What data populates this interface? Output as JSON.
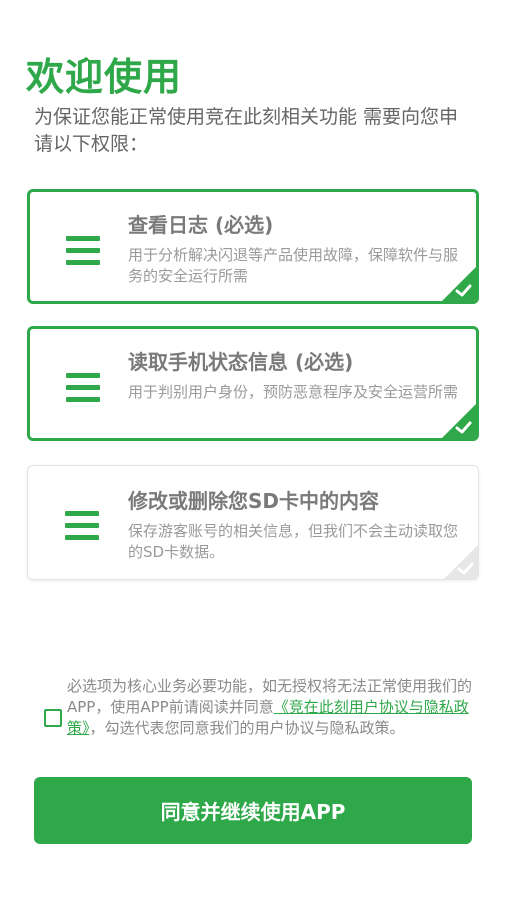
{
  "header": {
    "title": "欢迎使用",
    "subtitle": "为保证您能正常使用竞在此刻相关功能 需要向您申请以下权限："
  },
  "permissions": [
    {
      "title": "查看日志 (必选)",
      "description": "用于分析解决闪退等产品使用故障，保障软件与服务的安全运行所需",
      "checked": true
    },
    {
      "title": "读取手机状态信息 (必选)",
      "description": "用于判别用户身份，预防恶意程序及安全运营所需",
      "checked": true
    },
    {
      "title": "修改或删除您SD卡中的内容",
      "description": "保存游客账号的相关信息，但我们不会主动读取您的SD卡数据。",
      "checked": false
    }
  ],
  "agreement": {
    "checked": false,
    "text_before": "必选项为核心业务必要功能，如无授权将无法正常使用我们的APP，使用APP前请阅读并同意",
    "link": "《竞在此刻用户协议与隐私政策》",
    "text_after": "，勾选代表您同意我们的用户协议与隐私政策。"
  },
  "continue_button": "同意并继续使用APP",
  "colors": {
    "accent": "#2fa84a",
    "card_title": "#7a7a7a",
    "card_desc": "#9a9a9a",
    "unchecked_corner": "#e6e6e6"
  },
  "icons": {
    "permission": "menu-icon",
    "selected": "check-corner-icon"
  }
}
